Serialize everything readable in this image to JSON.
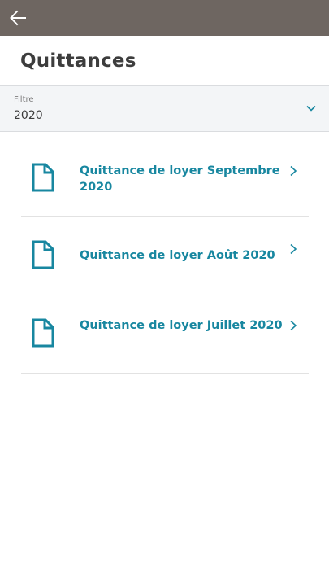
{
  "topbar": {
    "back_icon": "arrow-left-icon",
    "background": "#6e6661"
  },
  "page": {
    "title": "Quittances"
  },
  "filter": {
    "label": "Filtre",
    "value": "2020",
    "icon": "chevron-down-icon"
  },
  "receipts": [
    {
      "label": "Quittance de loyer Septembre 2020",
      "icon": "document-icon"
    },
    {
      "label": "Quittance de loyer Août 2020",
      "icon": "document-icon"
    },
    {
      "label": "Quittance de loyer Juillet 2020",
      "icon": "document-icon"
    }
  ],
  "colors": {
    "accent": "#1887a0",
    "title": "#3d3d3d",
    "filter_bg": "#f3f5f7"
  }
}
